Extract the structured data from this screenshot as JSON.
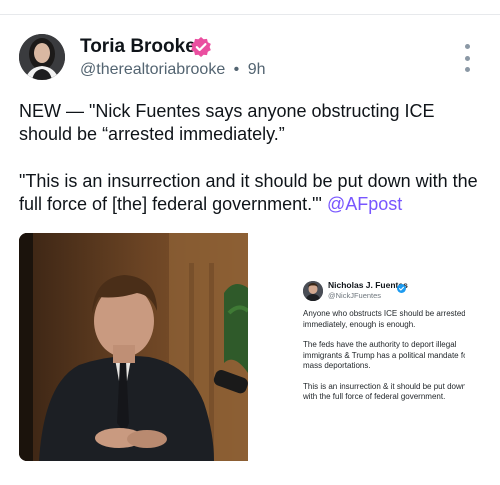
{
  "author": {
    "name": "Toria Brooke",
    "handle": "@therealtoriabrooke",
    "separator": "•",
    "time": "9h",
    "verified_color": "#ea4fa0"
  },
  "post": {
    "paragraphs": [
      "NEW — \"Nick Fuentes says anyone obstructing ICE should be “arrested immediately.”",
      "\"This is an insurrection and it should be put down with the full force of [the] federal government.\"'"
    ],
    "mention": "@AFpost",
    "mention_color": "#7856ff"
  },
  "embedded_post": {
    "name": "Nicholas J. Fuentes",
    "handle": "@NickJFuentes",
    "verified_color": "#1d9bf0",
    "paragraphs": [
      "Anyone who obstructs ICE should be arrested immediately, enough is enough.",
      "The feds have the authority to deport illegal immigrants & Trump has a political mandate for mass deportations.",
      "This is an insurrection & it should be put down with the full force of federal government."
    ]
  },
  "icons": {
    "more": "more-options-icon",
    "verified": "verified-badge-icon"
  }
}
